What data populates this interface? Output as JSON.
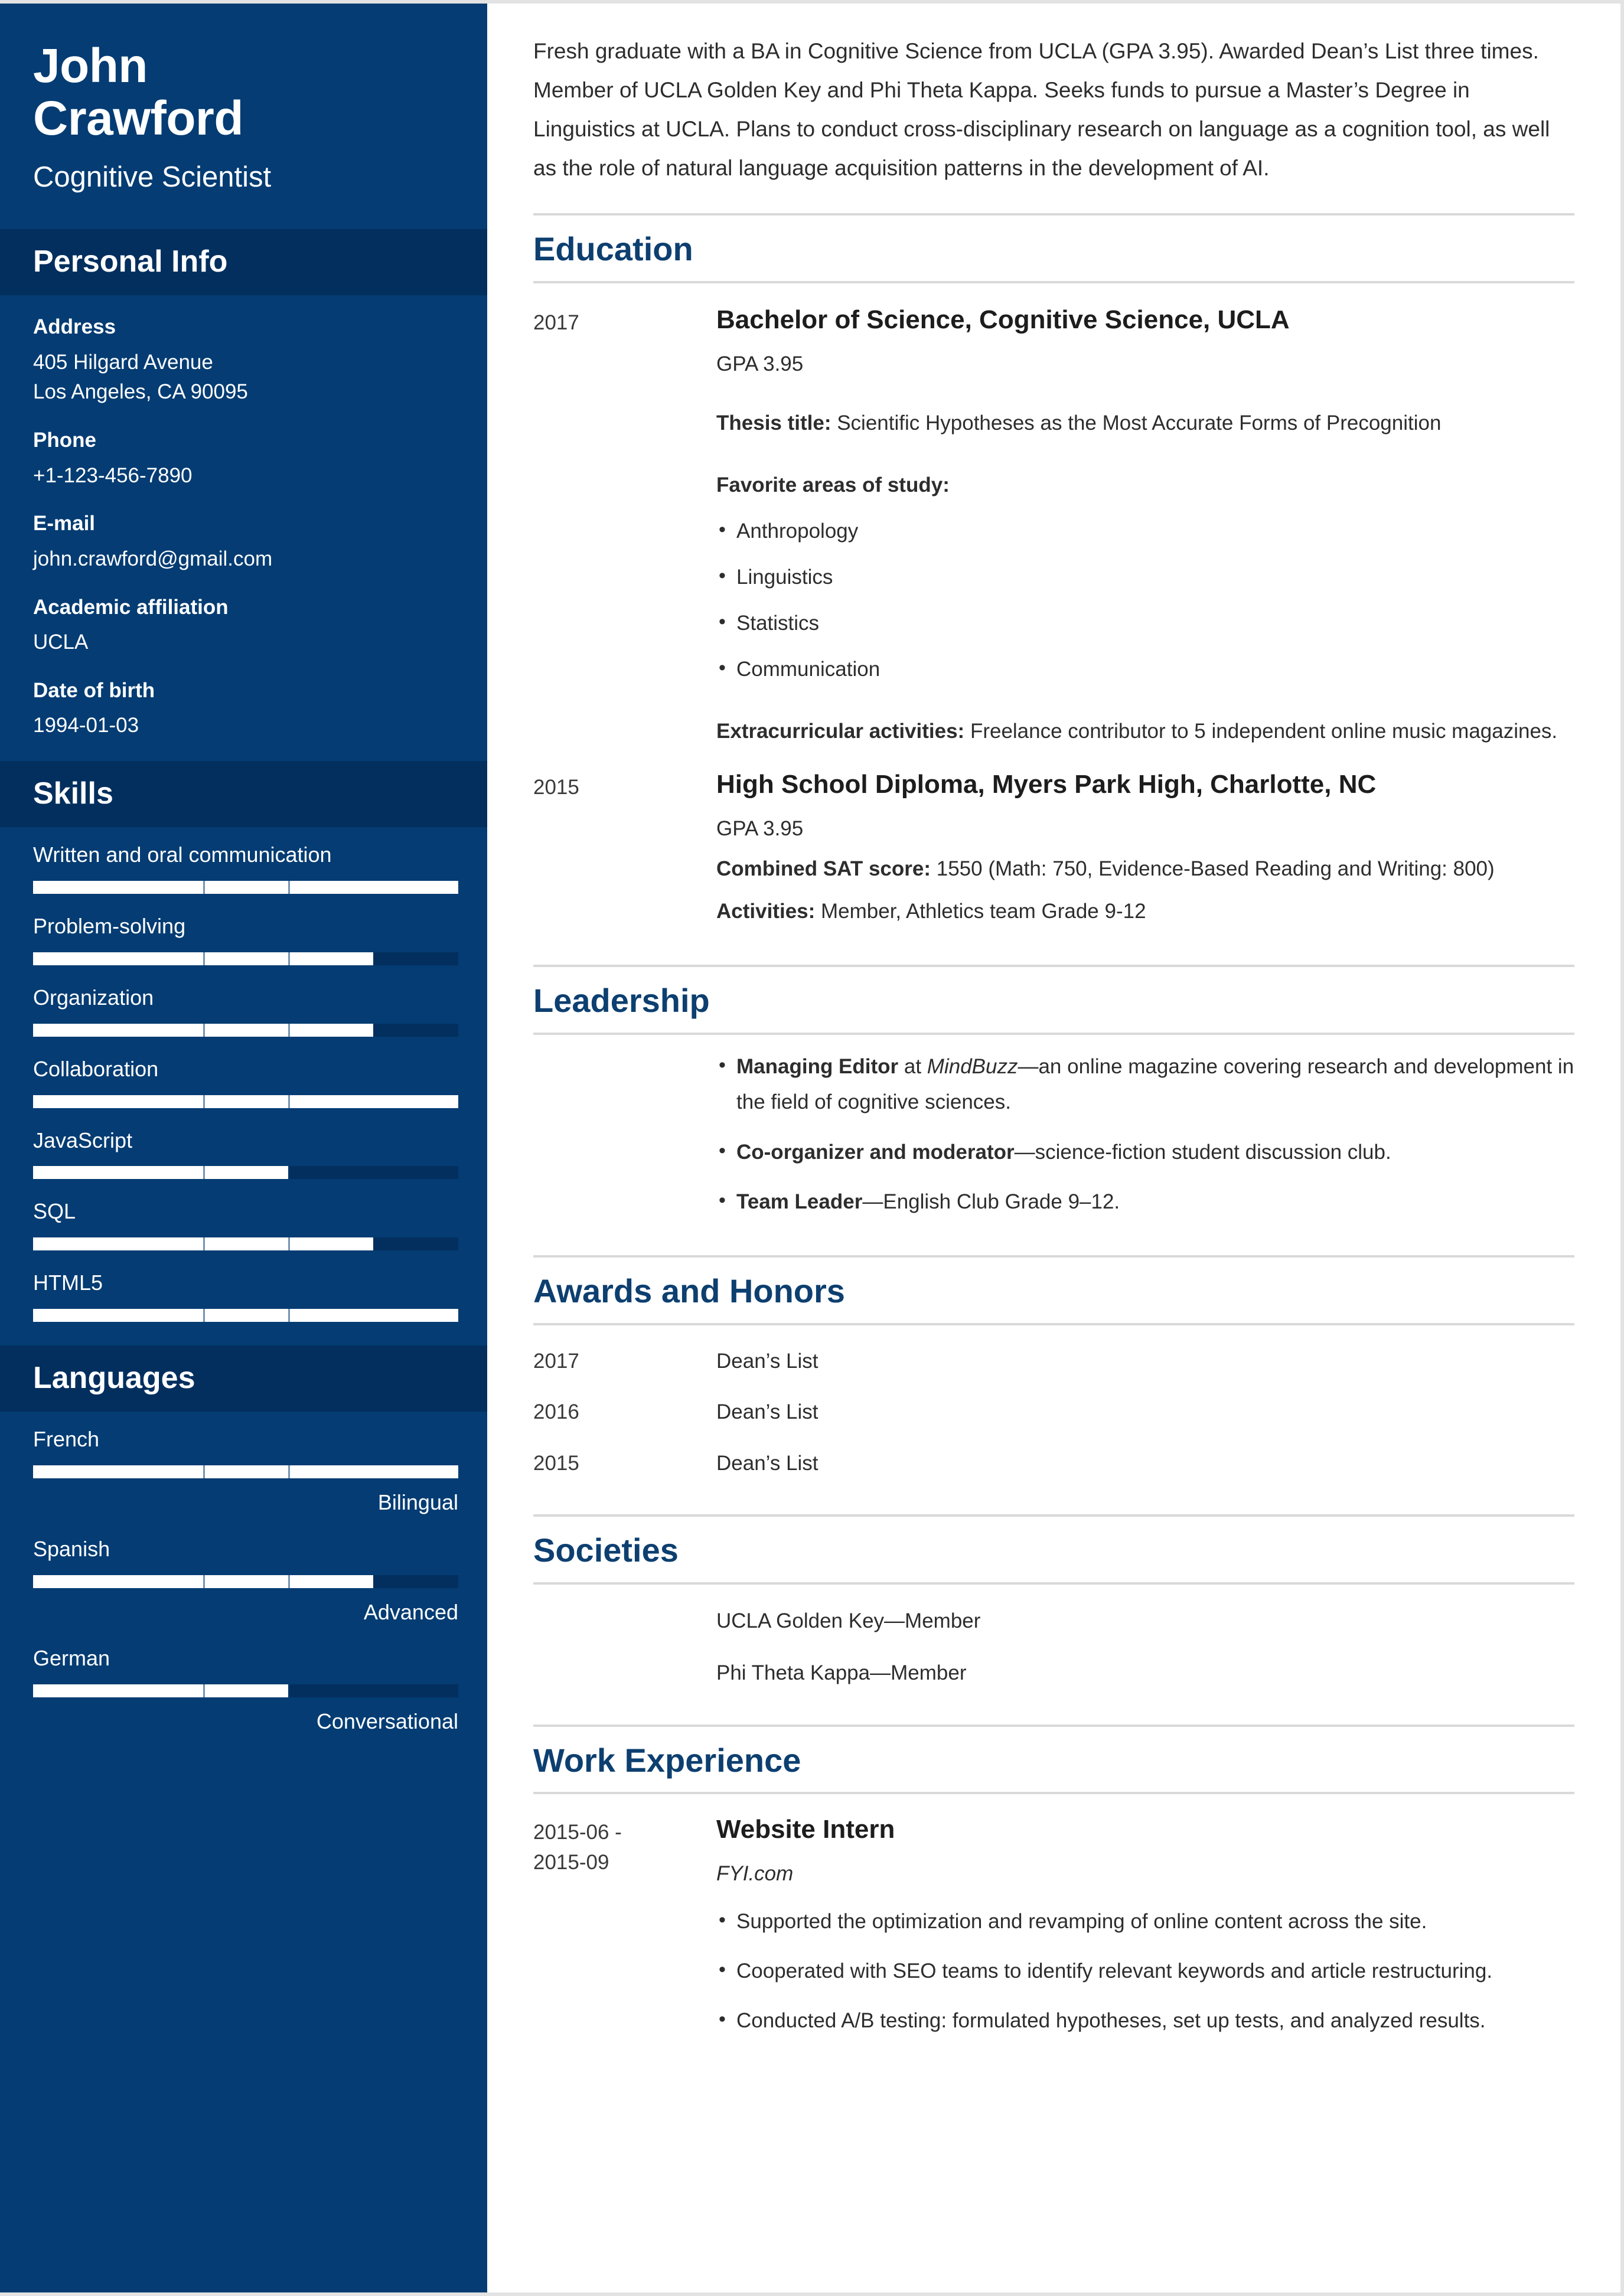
{
  "theme": {
    "sidebar_bg": "#043c73",
    "sidebar_header_bg": "#032f5e",
    "accent": "#0d3f70",
    "bar_fill": "#ffffff",
    "bar_track": "#032f5e",
    "rule": "#d9d9d9"
  },
  "identity": {
    "first_name": "John",
    "last_name": "Crawford",
    "job_title": "Cognitive Scientist"
  },
  "personal_info": {
    "heading": "Personal Info",
    "fields": [
      {
        "label": "Address",
        "value": "405 Hilgard Avenue",
        "value2": "Los Angeles, CA 90095"
      },
      {
        "label": "Phone",
        "value": "+1-123-456-7890"
      },
      {
        "label": "E-mail",
        "value": "john.crawford@gmail.com"
      },
      {
        "label": "Academic affiliation",
        "value": "UCLA"
      },
      {
        "label": "Date of birth",
        "value": "1994-01-03"
      }
    ]
  },
  "skills": {
    "heading": "Skills",
    "items": [
      {
        "name": "Written and oral communication",
        "percent": 100
      },
      {
        "name": "Problem-solving",
        "percent": 80
      },
      {
        "name": "Organization",
        "percent": 80
      },
      {
        "name": "Collaboration",
        "percent": 100
      },
      {
        "name": "JavaScript",
        "percent": 60
      },
      {
        "name": "SQL",
        "percent": 80
      },
      {
        "name": "HTML5",
        "percent": 100
      }
    ]
  },
  "languages": {
    "heading": "Languages",
    "items": [
      {
        "name": "French",
        "percent": 100,
        "level": "Bilingual"
      },
      {
        "name": "Spanish",
        "percent": 80,
        "level": "Advanced"
      },
      {
        "name": "German",
        "percent": 60,
        "level": "Conversational"
      }
    ]
  },
  "summary": {
    "text": "Fresh graduate with a BA in Cognitive Science from UCLA (GPA 3.95). Awarded Dean’s List three times. Member of UCLA Golden Key and Phi Theta Kappa. Seeks funds to pursue a Master’s Degree in Linguistics at UCLA. Plans to conduct cross-disciplinary research on language as a cognition tool, as well as the role of natural language acquisition patterns in the development of AI."
  },
  "education": {
    "heading": "Education",
    "entries": [
      {
        "year": "2017",
        "title": "Bachelor of Science, Cognitive Science, UCLA",
        "gpa": "GPA 3.95",
        "thesis_label": "Thesis title:",
        "thesis_value": " Scientific Hypotheses as the Most Accurate Forms of Precognition",
        "areas_label": "Favorite areas of study:",
        "areas": [
          "Anthropology",
          "Linguistics",
          "Statistics",
          "Communication"
        ],
        "extracurricular_label": "Extracurricular activities:",
        "extracurricular_value": " Freelance contributor to 5 independent online music magazines."
      },
      {
        "year": "2015",
        "title": "High School Diploma, Myers Park High, Charlotte, NC",
        "gpa": "GPA 3.95",
        "sat_label": "Combined SAT score:",
        "sat_value": " 1550 (Math: 750, Evidence-Based Reading and Writing: 800)",
        "activities_label": "Activities:",
        "activities_value": " Member, Athletics team Grade 9-12"
      }
    ]
  },
  "leadership": {
    "heading": "Leadership",
    "items": [
      {
        "bold": "Managing Editor",
        "mid": " at ",
        "italic": "MindBuzz",
        "rest": "—an online magazine covering research and development in the field of cognitive sciences."
      },
      {
        "bold": "Co-organizer and moderator",
        "mid": "",
        "italic": "",
        "rest": "—science-fiction student discussion club."
      },
      {
        "bold": "Team Leader",
        "mid": "",
        "italic": "",
        "rest": "—English Club Grade 9–12."
      }
    ]
  },
  "awards": {
    "heading": "Awards and Honors",
    "rows": [
      {
        "year": "2017",
        "label": "Dean’s List"
      },
      {
        "year": "2016",
        "label": "Dean’s List"
      },
      {
        "year": "2015",
        "label": "Dean’s List"
      }
    ]
  },
  "societies": {
    "heading": "Societies",
    "items": [
      "UCLA Golden Key—Member",
      "Phi Theta Kappa—Member"
    ]
  },
  "work": {
    "heading": "Work Experience",
    "entries": [
      {
        "date_from": "2015-06 -",
        "date_to": "2015-09",
        "role": "Website Intern",
        "company": "FYI.com",
        "bullets": [
          "Supported the optimization and revamping of online content across the site.",
          "Cooperated with SEO teams to identify relevant keywords and article restructuring.",
          "Conducted A/B testing: formulated hypotheses, set up tests, and analyzed results."
        ]
      }
    ]
  }
}
